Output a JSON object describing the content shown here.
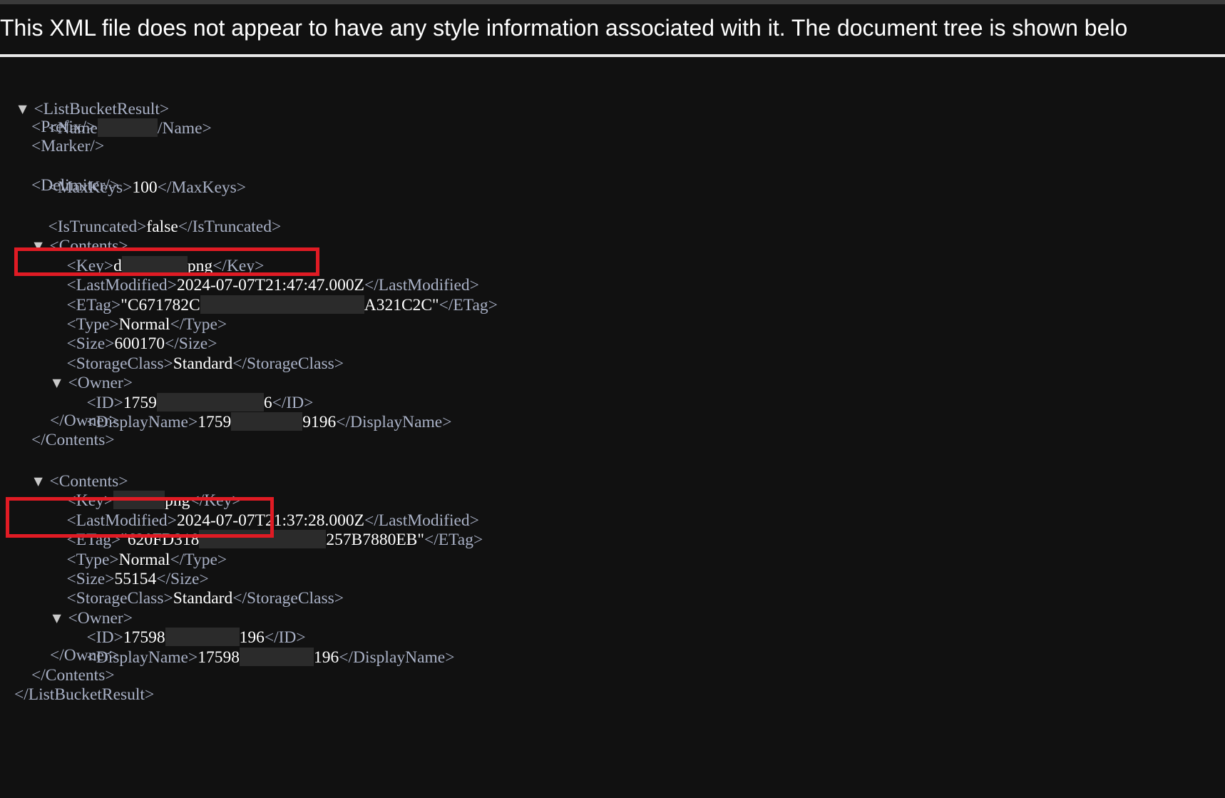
{
  "banner": {
    "message": "This XML file does not appear to have any style information associated with it. The document tree is shown belo"
  },
  "tree": {
    "root_open": "<ListBucketResult>",
    "root_close": "</ListBucketResult>",
    "name_open": "<Name",
    "name_close": "/Name>",
    "prefix": "<Prefix/>",
    "marker": "<Marker/>",
    "maxkeys_open": "<MaxKeys>",
    "maxkeys_value": "100",
    "maxkeys_close": "</MaxKeys>",
    "delimiter": "<Delimiter/>",
    "istruncated_open": "<IsTruncated>",
    "istruncated_value": "false",
    "istruncated_close": "</IsTruncated>",
    "contents": [
      {
        "open": "<Contents>",
        "close": "</Contents>",
        "key_open": "<Key>",
        "key_prefix": "d",
        "key_suffix": "png",
        "key_close": "</Key>",
        "lastmod_open": "<LastModified>",
        "lastmod_value": "2024-07-07T21:47:47.000Z",
        "lastmod_close": "</LastModified>",
        "etag_open": "<ETag>",
        "etag_prefix": "\"C671782C",
        "etag_suffix": "A321C2C\"",
        "etag_close": "</ETag>",
        "type_open": "<Type>",
        "type_value": "Normal",
        "type_close": "</Type>",
        "size_open": "<Size>",
        "size_value": "600170",
        "size_close": "</Size>",
        "storage_open": "<StorageClass>",
        "storage_value": "Standard",
        "storage_close": "</StorageClass>",
        "owner_open": "<Owner>",
        "owner_close": "</Owner>",
        "id_open": "<ID>",
        "id_prefix": "1759",
        "id_suffix": "6",
        "id_close": "</ID>",
        "display_open": "<DisplayName>",
        "display_prefix": "1759",
        "display_suffix": "9196",
        "display_close": "</DisplayName>"
      },
      {
        "open": "<Contents>",
        "close": "</Contents>",
        "key_open": "<Key>",
        "key_prefix": "",
        "key_suffix": "png",
        "key_close": "</Key>",
        "lastmod_open": "<LastModified>",
        "lastmod_value": "2024-07-07T21:37:28.000Z",
        "lastmod_close": "</LastModified>",
        "etag_open": "<ETag>",
        "etag_prefix": "\"620FD318",
        "etag_suffix": "257B7880EB\"",
        "etag_close": "</ETag>",
        "type_open": "<Type>",
        "type_value": "Normal",
        "type_close": "</Type>",
        "size_open": "<Size>",
        "size_value": "55154",
        "size_close": "</Size>",
        "storage_open": "<StorageClass>",
        "storage_value": "Standard",
        "storage_close": "</StorageClass>",
        "owner_open": "<Owner>",
        "owner_close": "</Owner>",
        "id_open": "<ID>",
        "id_prefix": "17598",
        "id_suffix": "196",
        "id_close": "</ID>",
        "display_open": "<DisplayName>",
        "display_prefix": "17598",
        "display_suffix": "196",
        "display_close": "</DisplayName>"
      }
    ]
  },
  "icons": {
    "expanded": "expand-arrow-icon"
  },
  "colors": {
    "background": "#111111",
    "tag": "#a9b1c6",
    "value": "#ffffff",
    "highlight": "#e01b24"
  }
}
